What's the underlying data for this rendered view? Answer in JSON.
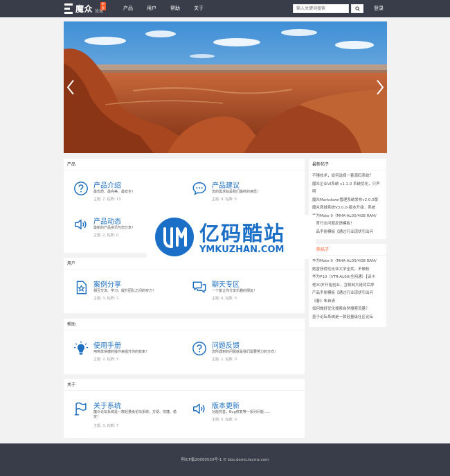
{
  "header": {
    "logo_text": "魔众",
    "logo_sub": "论坛",
    "logo_badge": "新版",
    "nav": [
      "产品",
      "用户",
      "帮助",
      "关于"
    ],
    "search_placeholder": "输入关键词搜索",
    "login": "登录"
  },
  "sections": [
    {
      "title": "产品",
      "forums": [
        {
          "title": "产品介绍",
          "desc": "最优质、最完美、最安全！",
          "stats": "主题: 7, 帖数: 13",
          "icon": "question-circle-icon"
        },
        {
          "title": "产品建议",
          "desc": "您的需求就是我们最终的意愿！",
          "stats": "主题: 4, 帖数: 5",
          "icon": "chat-bubble-icon"
        },
        {
          "title": "产品动态",
          "desc": "最新的产品资讯与您分享！",
          "stats": "主题: 2, 帖数: 0",
          "icon": "speaker-icon"
        }
      ]
    },
    {
      "title": "用户",
      "forums": [
        {
          "title": "案例分享",
          "desc": "相互交流、学习，提升团队之间的实力！",
          "stats": "主题: 3, 帖数: 2",
          "icon": "star-document-icon"
        },
        {
          "title": "聊天专区",
          "desc": "一个能让你分享乐趣的朋友！",
          "stats": "主题: 4, 帖数: 5",
          "icon": "chat-bubbles-icon"
        }
      ]
    },
    {
      "title": "帮助",
      "forums": [
        {
          "title": "使用手册",
          "desc": "用简单快捷的操作来提升你的效率！",
          "stats": "主题: 2, 帖数: 3",
          "icon": "lightbulb-icon"
        },
        {
          "title": "问题反馈",
          "desc": "您所遇到的问题就是我们需要努力的方向！",
          "stats": "主题: 1, 帖数: 0",
          "icon": "question-circle-icon"
        }
      ]
    },
    {
      "title": "关于",
      "forums": [
        {
          "title": "关于系统",
          "desc": "魔众论坛系统是一款轻量级论坛系统，方便、快捷、稳定！",
          "stats": "主题: 3, 帖数: 7",
          "icon": "flag-icon"
        },
        {
          "title": "版本更新",
          "desc": "功能完善，Bug修复等一系列问题......",
          "stats": "主题: 0, 帖数: 0",
          "icon": "speaker-icon"
        }
      ]
    }
  ],
  "sidebar": {
    "latest_title": "最新帖子",
    "latest": [
      "不懂技术，如何选择一套源码系统？",
      "魔众企业VI系统 v1.1.0 系统优化，只声明",
      "魔众Markdown管理系统发布v2.0.0版",
      "魔众商城系统V3.0.0-版本升级，系统",
      "华为Mate 9（MHA-AL00/4GB RAM/",
      "教育行业问题反馈模板！",
      "产品手册模板【通过行业现状引出问"
    ],
    "hot_title": "最热帖子",
    "hot": [
      "华为Mate 9（MHA-AL00/4GB RAM/",
      "她曾获荷伦比亚大学全奖，不做校",
      "华为P10（VTR-AL00/全网通）【译卡",
      "他30岁开始创业，互联网大佬背后撑",
      "产品手册模板【通过行业现状引出问",
      "《春》朱自清",
      "如何做好优化搜索自然搜索流量？",
      "墨子论坛系统是一款轻量级社区论坛"
    ]
  },
  "watermark": {
    "title": "亿码酷站",
    "sub": "YMKUZHAN.COM"
  },
  "footer": {
    "text": "阿ICP备20000530号-1 © bbs.demo.tecmz.com"
  },
  "colors": {
    "topbar": "#393d49",
    "accent": "#1e6fbf",
    "hot": "#ff5722"
  }
}
